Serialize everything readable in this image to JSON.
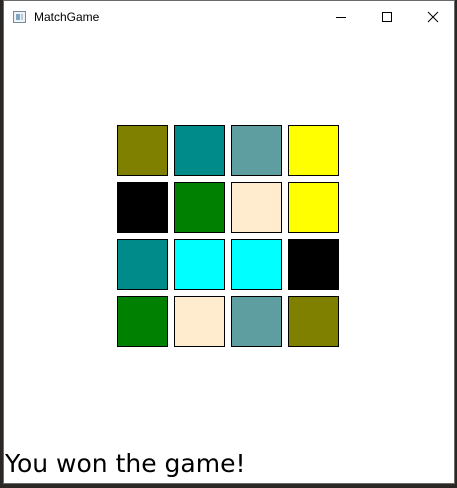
{
  "window": {
    "title": "MatchGame"
  },
  "board": {
    "rows": [
      [
        {
          "color": "#808000"
        },
        {
          "color": "#008B8B"
        },
        {
          "color": "#5F9EA0"
        },
        {
          "color": "#FFFF00"
        }
      ],
      [
        {
          "color": "#000000"
        },
        {
          "color": "#008000"
        },
        {
          "color": "#FFEBCD"
        },
        {
          "color": "#FFFF00"
        }
      ],
      [
        {
          "color": "#008B8B"
        },
        {
          "color": "#00FFFF"
        },
        {
          "color": "#00FFFF"
        },
        {
          "color": "#000000"
        }
      ],
      [
        {
          "color": "#008000"
        },
        {
          "color": "#FFEBCD"
        },
        {
          "color": "#5F9EA0"
        },
        {
          "color": "#808000"
        }
      ]
    ]
  },
  "status": {
    "text": "You won the game!"
  }
}
